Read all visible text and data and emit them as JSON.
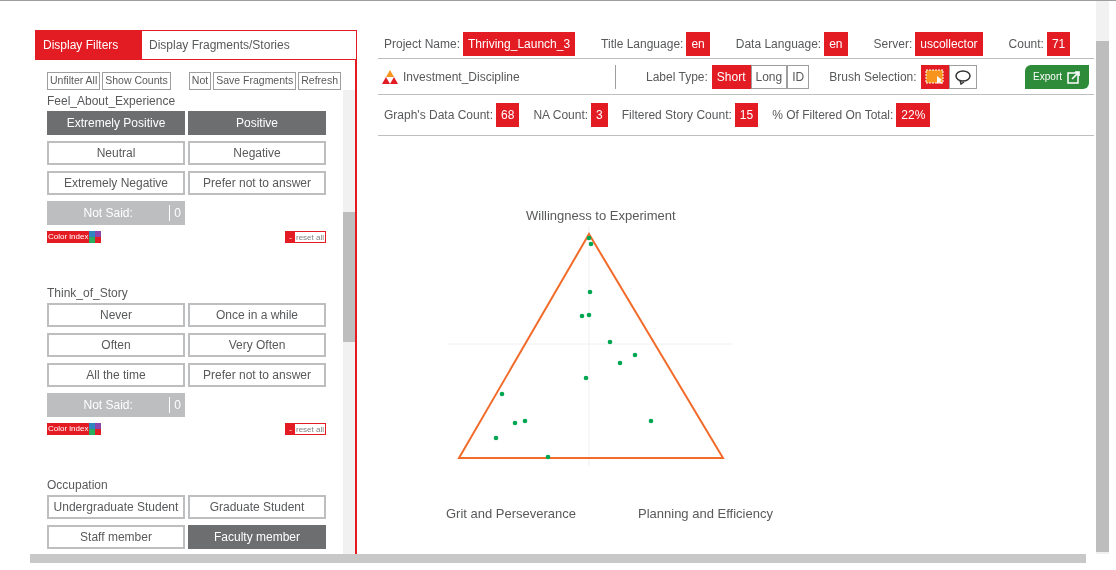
{
  "panel_tabs": [
    {
      "label": "Display Filters",
      "selected": true
    },
    {
      "label": "Display Fragments/Stories",
      "selected": false
    }
  ],
  "toolbar_left": [
    "Unfilter All",
    "Show Counts"
  ],
  "toolbar_right": [
    "Not",
    "Save Fragments",
    "Refresh"
  ],
  "filters": [
    {
      "title": "Feel_About_Experience",
      "options": [
        {
          "label": "Extremely Positive",
          "selected": true
        },
        {
          "label": "Positive",
          "selected": true
        },
        {
          "label": "Neutral",
          "selected": false
        },
        {
          "label": "Negative",
          "selected": false
        },
        {
          "label": "Extremely Negative",
          "selected": false
        },
        {
          "label": "Prefer not to answer",
          "selected": false
        }
      ],
      "not_said": {
        "label": "Not Said:",
        "count": "0"
      },
      "color_index": "Color index",
      "reset_mark": "-",
      "reset": "reset all"
    },
    {
      "title": "Think_of_Story",
      "options": [
        {
          "label": "Never",
          "selected": false
        },
        {
          "label": "Once in a while",
          "selected": false
        },
        {
          "label": "Often",
          "selected": false
        },
        {
          "label": "Very Often",
          "selected": false
        },
        {
          "label": "All the time",
          "selected": false
        },
        {
          "label": "Prefer not to answer",
          "selected": false
        }
      ],
      "not_said": {
        "label": "Not Said:",
        "count": "0"
      },
      "color_index": "Color index",
      "reset_mark": "-",
      "reset": "reset all"
    },
    {
      "title": "Occupation",
      "options": [
        {
          "label": "Undergraduate Student",
          "selected": false
        },
        {
          "label": "Graduate Student",
          "selected": false
        },
        {
          "label": "Staff member",
          "selected": false
        },
        {
          "label": "Faculty member",
          "selected": true
        }
      ]
    }
  ],
  "info": [
    {
      "label": "Project Name:",
      "value": "Thriving_Launch_3"
    },
    {
      "label": "Title Language:",
      "value": "en"
    },
    {
      "label": "Data Language:",
      "value": "en"
    },
    {
      "label": "Server:",
      "value": "uscollector"
    },
    {
      "label": "Count:",
      "value": "71"
    }
  ],
  "graph_title": "Investment_Discipline",
  "label_type": {
    "label": "Label Type:",
    "options": [
      {
        "label": "Short",
        "selected": true
      },
      {
        "label": "Long",
        "selected": false
      },
      {
        "label": "ID",
        "selected": false
      }
    ]
  },
  "brush": {
    "label": "Brush Selection:",
    "tools": [
      {
        "kind": "rectangle",
        "selected": true
      },
      {
        "kind": "lasso",
        "selected": false
      }
    ]
  },
  "export": "Export",
  "stats": [
    {
      "label": "Graph's Data Count:",
      "value": "68"
    },
    {
      "label": "NA Count:",
      "value": "3"
    },
    {
      "label": "Filtered Story Count:",
      "value": "15"
    },
    {
      "label": "% Of Filtered On Total:",
      "value": "22%"
    }
  ],
  "plot": {
    "top": "Willingness to Experiment",
    "left": "Grit and Perseverance",
    "right": "Planning and Efficiency"
  }
}
